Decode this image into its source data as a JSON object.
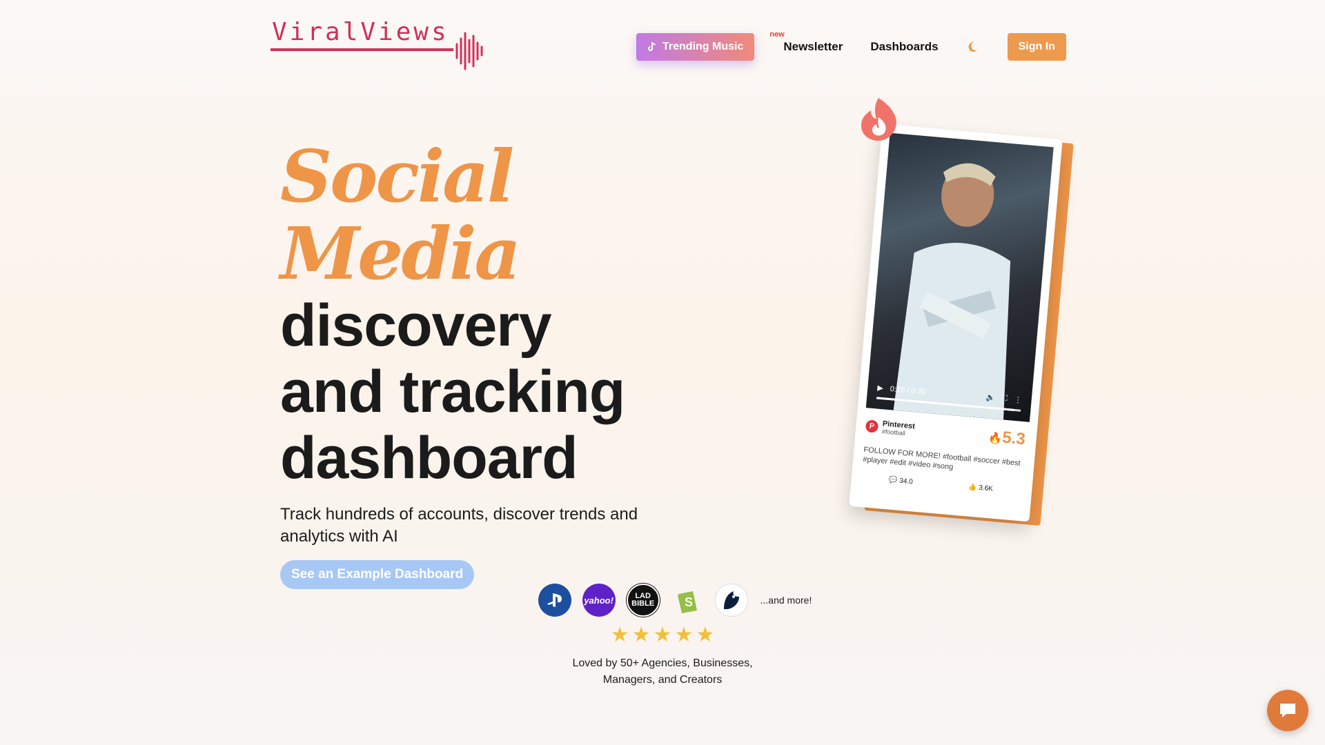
{
  "brand": {
    "logo_text": "ViralViews"
  },
  "nav": {
    "trending_label": "Trending Music",
    "new_badge": "new",
    "newsletter_label": "Newsletter",
    "dashboards_label": "Dashboards",
    "signin_label": "Sign In"
  },
  "hero": {
    "script_line": "Social Media",
    "line1": "discovery",
    "line2": "and tracking",
    "line3": "dashboard",
    "sub_before": "Track hundreds of accounts, discover ",
    "sub_highlight": "trends",
    "sub_after": " and analytics with AI",
    "cta_label": "See an Example Dashboard"
  },
  "card": {
    "time": "0:19 / 0:20",
    "progress": 0.95,
    "platform": "Pinterest",
    "tag": "#football",
    "score": "5.3",
    "description": "FOLLOW FOR MORE! #football #soccer #best #player #edit #video #song",
    "comments": "34.0",
    "likes": "3.6K"
  },
  "proof": {
    "logos": [
      "PlayStation",
      "yahoo!",
      "LAD BIBLE",
      "Shopify",
      "Team Liquid"
    ],
    "more": "...and more!",
    "stars": 5,
    "loved_line1": "Loved by 50+ Agencies, Businesses,",
    "loved_line2": "Managers, and Creators"
  },
  "colors": {
    "accent": "#ee9548",
    "brand": "#d0305a",
    "cta_blue": "#a7c8f5"
  }
}
